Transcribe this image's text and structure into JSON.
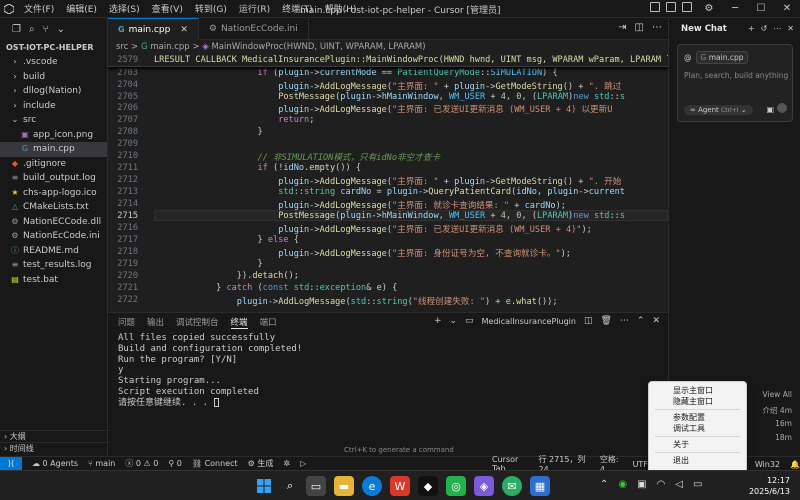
{
  "titlebar": {
    "menus": [
      "文件(F)",
      "编辑(E)",
      "选择(S)",
      "查看(V)",
      "转到(G)",
      "运行(R)",
      "终端(T)",
      "帮助(H)"
    ],
    "title": "main.cpp - ost-iot-pc-helper - Cursor [管理员]"
  },
  "sidebar": {
    "project": "OST-IOT-PC-HELPER",
    "items": [
      {
        "label": ".vscode",
        "type": "folder"
      },
      {
        "label": "build",
        "type": "folder"
      },
      {
        "label": "dllog(Nation)",
        "type": "folder"
      },
      {
        "label": "include",
        "type": "folder"
      },
      {
        "label": "src",
        "type": "folder-open"
      },
      {
        "label": "app_icon.png",
        "type": "image"
      },
      {
        "label": "main.cpp",
        "type": "cpp"
      },
      {
        "label": ".gitignore",
        "type": "git"
      },
      {
        "label": "build_output.log",
        "type": "log"
      },
      {
        "label": "chs-app-logo.ico",
        "type": "star"
      },
      {
        "label": "CMakeLists.txt",
        "type": "cmake"
      },
      {
        "label": "NationECCode.dll",
        "type": "dll"
      },
      {
        "label": "NationEcCode.ini",
        "type": "ini"
      },
      {
        "label": "README.md",
        "type": "md"
      },
      {
        "label": "test_results.log",
        "type": "log"
      },
      {
        "label": "test.bat",
        "type": "bat"
      }
    ],
    "outline": "大纲",
    "timeline": "时间线"
  },
  "tabs": [
    {
      "label": "main.cpp",
      "active": true
    },
    {
      "label": "NationEcCode.ini",
      "active": false
    }
  ],
  "breadcrumb": {
    "p1": "src",
    "p2": "main.cpp",
    "p3": "MainWindowProc(HWND, UINT, WPARAM, LPARAM)",
    "sep": ">"
  },
  "editor": {
    "sticky_line": "2579",
    "sticky_code": "LRESULT CALLBACK MedicalInsurancePlugin::MainWindowProc(HWND hwnd, UINT msg, WPARAM wParam, LPARAM lParam",
    "line_numbers": [
      "2703",
      "2704",
      "2705",
      "2706",
      "2707",
      "2708",
      "2709",
      "2710",
      "2711",
      "2712",
      "2713",
      "2714",
      "2715",
      "2716",
      "2717",
      "2718",
      "2719",
      "2720",
      "2721",
      "2722"
    ],
    "current_line": "2715"
  },
  "panel": {
    "tabs": [
      "问题",
      "输出",
      "调试控制台",
      "终端",
      "端口"
    ],
    "active_tab": "终端",
    "terminal_name": "MedicalInsurancePlugin",
    "terminal_lines": [
      "All files copied successfully",
      "",
      "Build and configuration completed!",
      "",
      "Run the program? [Y/N]",
      "y",
      "Starting program...",
      "",
      "Script execution completed",
      "请按任意键继续. . . "
    ],
    "hint": "Ctrl+K to generate a command"
  },
  "chat": {
    "title": "New Chat",
    "file_chip": "main.cpp",
    "placeholder": "Plan, search, build anything",
    "agent": "Agent",
    "agent_shortcut": "Ctrl+I",
    "view_all": "View All",
    "recent": [
      {
        "suffix": "介绍",
        "age": "4m"
      },
      {
        "suffix": "",
        "age": "16m"
      },
      {
        "suffix": "",
        "age": "18m"
      }
    ]
  },
  "statusbar": {
    "agents": "0 Agents",
    "branch": "main",
    "errors": "0",
    "warnings": "0",
    "ports": "0",
    "connect": "Connect",
    "build": "生成",
    "cursor_tab": "Cursor Tab",
    "position": "行 2715，列 24",
    "spaces": "空格: 4",
    "encoding": "UTF-",
    "platform": "Win32"
  },
  "context_menu": {
    "items": [
      "显示主窗口",
      "隐藏主窗口",
      "参数配置",
      "调试工具",
      "关于",
      "退出"
    ]
  },
  "taskbar": {
    "time": "12:17",
    "date": "2025/6/13"
  },
  "colors": {
    "accent": "#0078d4",
    "editor_bg": "#1f1f1f",
    "sidebar_bg": "#181818"
  }
}
